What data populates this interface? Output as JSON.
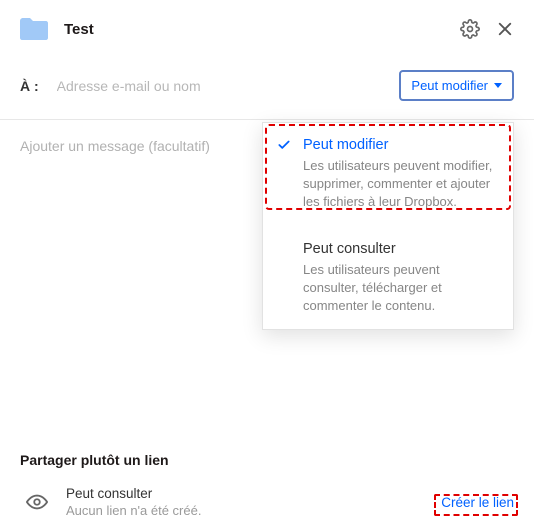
{
  "header": {
    "title": "Test"
  },
  "share": {
    "to_label": "À :",
    "email_placeholder": "Adresse e-mail ou nom",
    "message_placeholder": "Ajouter un message (facultatif)"
  },
  "perm_button": {
    "label": "Peut modifier"
  },
  "dropdown": {
    "options": [
      {
        "title": "Peut modifier",
        "desc": "Les utilisateurs peuvent modifier, supprimer, commenter et ajouter les fichiers à leur Dropbox.",
        "selected": true
      },
      {
        "title": "Peut consulter",
        "desc": "Les utilisateurs peuvent consulter, télécharger et commenter le contenu.",
        "selected": false
      }
    ]
  },
  "link_section": {
    "heading": "Partager plutôt un lien",
    "perm": "Peut consulter",
    "status": "Aucun lien n'a été créé.",
    "create": "Créer le lien"
  }
}
